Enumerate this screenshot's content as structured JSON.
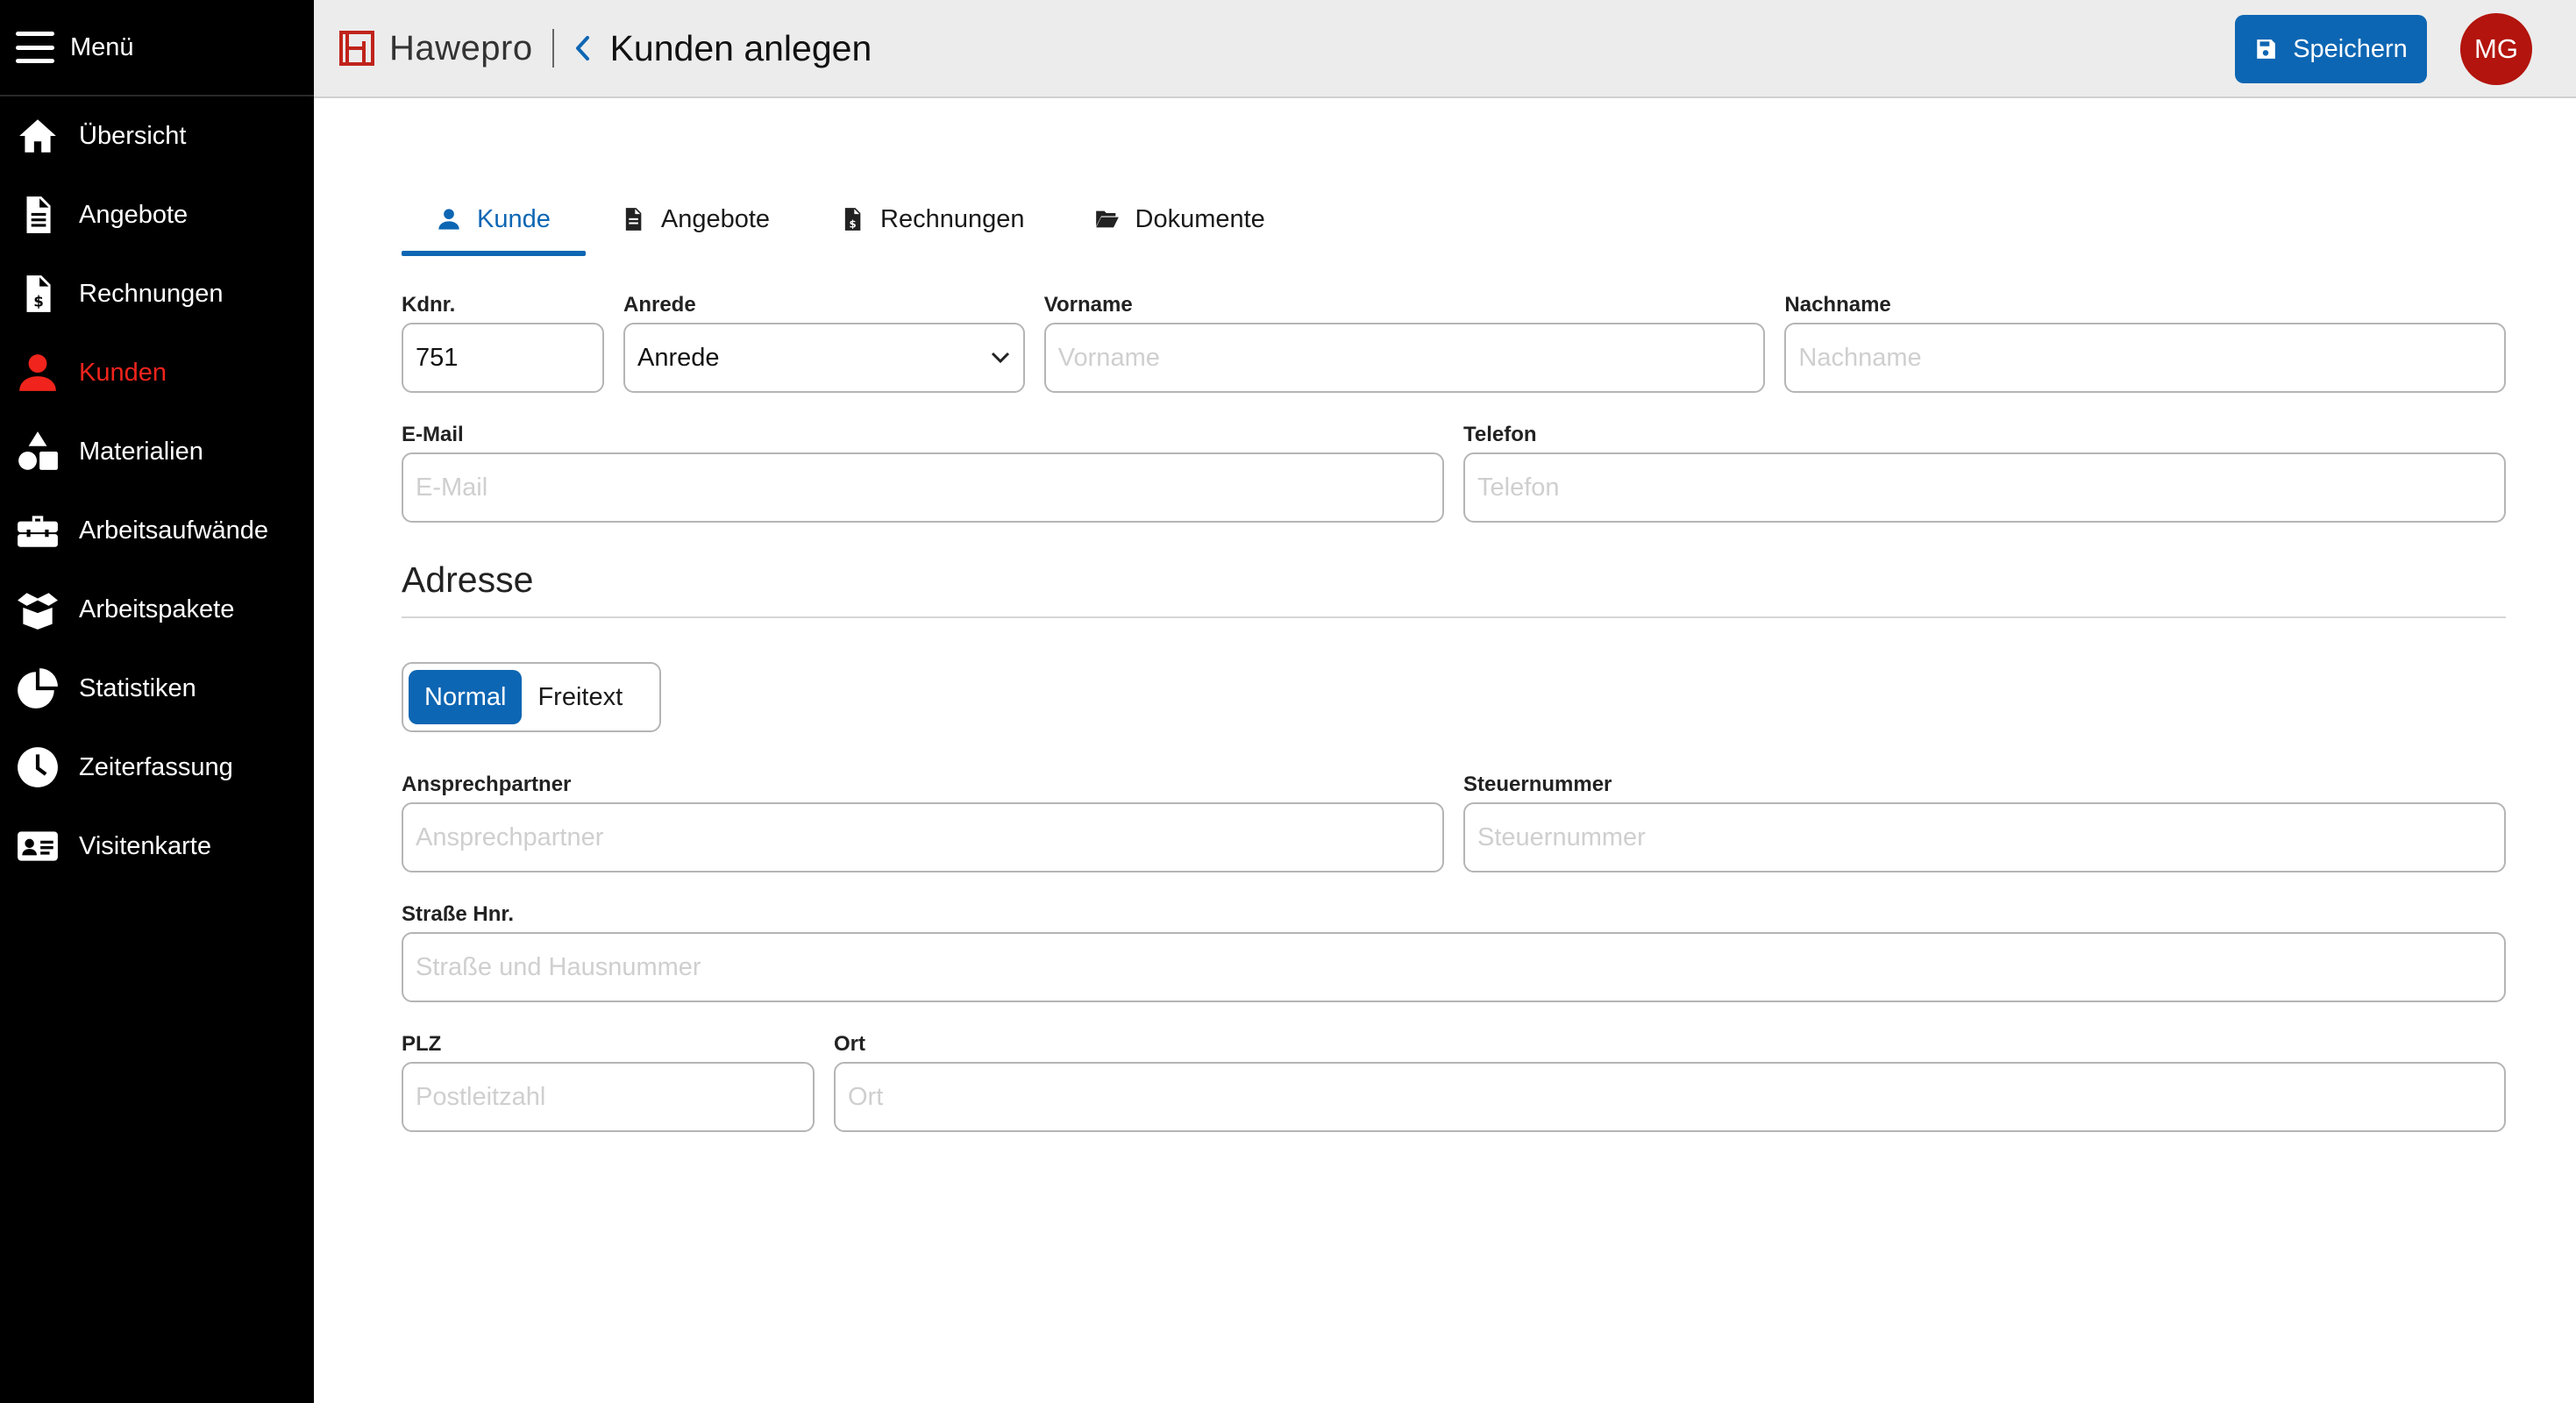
{
  "sidebar": {
    "menu_label": "Menü",
    "items": [
      {
        "label": "Übersicht",
        "icon": "home-icon",
        "active": false
      },
      {
        "label": "Angebote",
        "icon": "document-icon",
        "active": false
      },
      {
        "label": "Rechnungen",
        "icon": "invoice-icon",
        "active": false
      },
      {
        "label": "Kunden",
        "icon": "user-icon",
        "active": true
      },
      {
        "label": "Materialien",
        "icon": "shapes-icon",
        "active": false
      },
      {
        "label": "Arbeitsaufwände",
        "icon": "toolbox-icon",
        "active": false
      },
      {
        "label": "Arbeitspakete",
        "icon": "box-open-icon",
        "active": false
      },
      {
        "label": "Statistiken",
        "icon": "pie-chart-icon",
        "active": false
      },
      {
        "label": "Zeiterfassung",
        "icon": "clock-icon",
        "active": false
      },
      {
        "label": "Visitenkarte",
        "icon": "id-card-icon",
        "active": false
      }
    ]
  },
  "header": {
    "logo_text": "Hawepro",
    "title": "Kunden anlegen",
    "save_label": "Speichern",
    "avatar_initials": "MG"
  },
  "tabs": [
    {
      "label": "Kunde",
      "icon": "user-icon",
      "active": true
    },
    {
      "label": "Angebote",
      "icon": "document-icon",
      "active": false
    },
    {
      "label": "Rechnungen",
      "icon": "invoice-icon",
      "active": false
    },
    {
      "label": "Dokumente",
      "icon": "folder-open-icon",
      "active": false
    }
  ],
  "form": {
    "kdnr": {
      "label": "Kdnr.",
      "value": "751"
    },
    "anrede": {
      "label": "Anrede",
      "value": "Anrede"
    },
    "vorname": {
      "label": "Vorname",
      "placeholder": "Vorname"
    },
    "nachname": {
      "label": "Nachname",
      "placeholder": "Nachname"
    },
    "email": {
      "label": "E-Mail",
      "placeholder": "E-Mail"
    },
    "telefon": {
      "label": "Telefon",
      "placeholder": "Telefon"
    }
  },
  "address": {
    "section_title": "Adresse",
    "toggle": {
      "options": [
        "Normal",
        "Freitext"
      ],
      "selected": "Normal"
    },
    "ansprechpartner": {
      "label": "Ansprechpartner",
      "placeholder": "Ansprechpartner"
    },
    "steuernummer": {
      "label": "Steuernummer",
      "placeholder": "Steuernummer"
    },
    "strasse": {
      "label": "Straße Hnr.",
      "placeholder": "Straße und Hausnummer"
    },
    "plz": {
      "label": "PLZ",
      "placeholder": "Postleitzahl"
    },
    "ort": {
      "label": "Ort",
      "placeholder": "Ort"
    }
  },
  "colors": {
    "accent": "#0d66b3",
    "active_nav": "#f0241c",
    "avatar_bg": "#b3140d",
    "sidebar_bg": "#000000",
    "header_bg": "#ececec"
  }
}
